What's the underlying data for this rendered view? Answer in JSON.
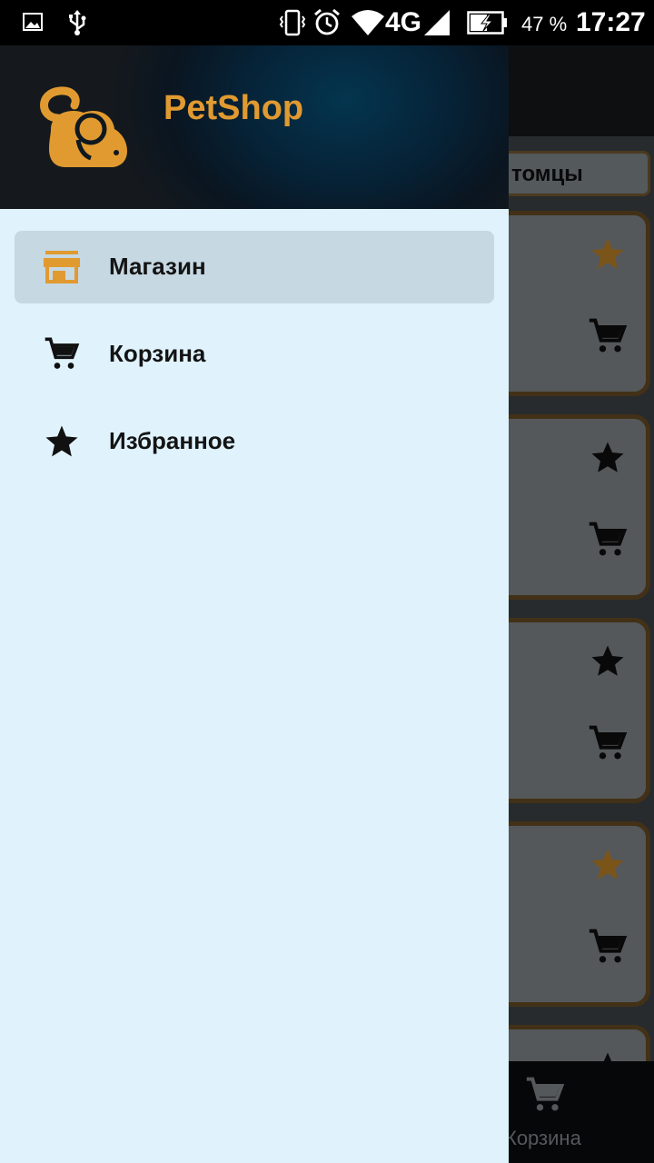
{
  "status_bar": {
    "network": "4G",
    "battery": "47 %",
    "time": "17:27",
    "icons": [
      "image-icon",
      "usb-icon",
      "vibrate-icon",
      "alarm-icon",
      "wifi-icon",
      "signal-icon",
      "battery-charging-icon"
    ]
  },
  "background": {
    "chip_label": "томцы",
    "bottom_nav_label": "Корзина",
    "cards": [
      {
        "favorite": true
      },
      {
        "favorite": false
      },
      {
        "favorite": false
      },
      {
        "favorite": true
      },
      {
        "favorite": false
      }
    ]
  },
  "drawer": {
    "app_name": "PetShop",
    "logo_icon": "mouse-logo-icon",
    "items": [
      {
        "label": "Магазин",
        "icon": "store-icon",
        "selected": true
      },
      {
        "label": "Корзина",
        "icon": "cart-icon",
        "selected": false
      },
      {
        "label": "Избранное",
        "icon": "star-icon",
        "selected": false
      }
    ]
  },
  "colors": {
    "accent": "#e19a30",
    "drawer_bg": "#e0f3fd",
    "selected_bg": "#c6d8e2",
    "card_border": "#7a5a2a"
  }
}
